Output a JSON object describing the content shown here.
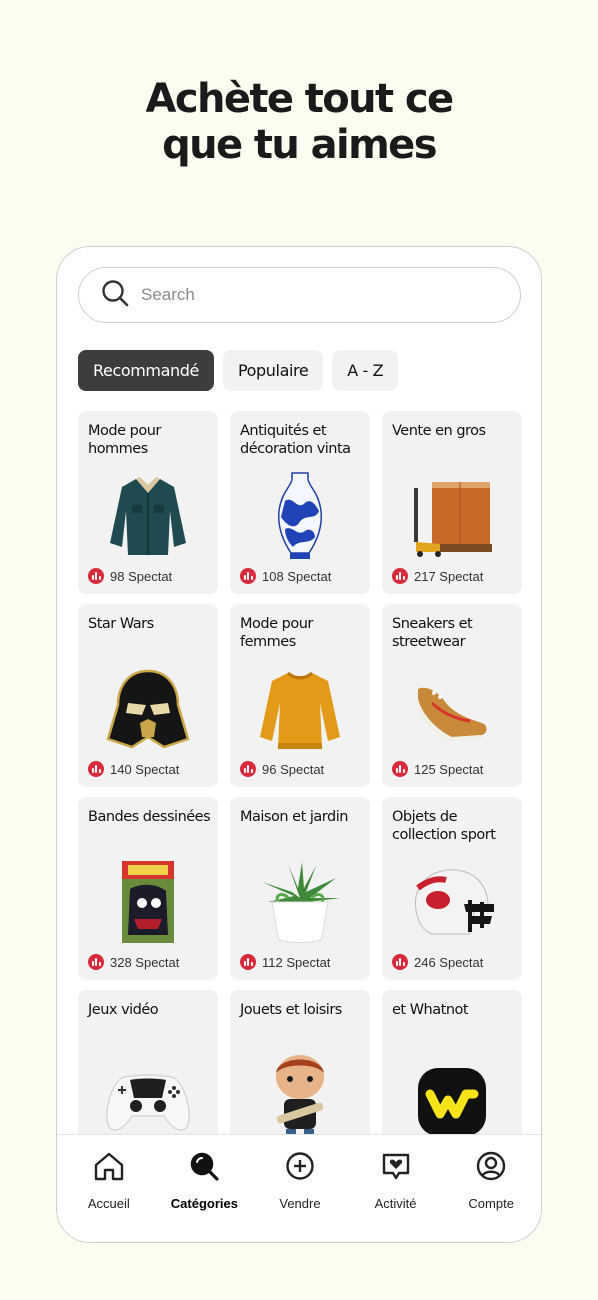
{
  "headline": {
    "line1": "Achète tout ce",
    "line2": "que tu aimes"
  },
  "search": {
    "placeholder": "Search",
    "value": ""
  },
  "tabs": [
    {
      "label": "Recommandé",
      "active": true
    },
    {
      "label": "Populaire",
      "active": false
    },
    {
      "label": "A - Z",
      "active": false
    }
  ],
  "categories": [
    {
      "title": "Mode pour hommes",
      "viewers": "98 Spectat",
      "image": "denim-jacket"
    },
    {
      "title": "Antiquités et décoration vinta",
      "viewers": "108 Spectat",
      "image": "blue-porcelain-vase"
    },
    {
      "title": "Vente en gros",
      "viewers": "217 Spectat",
      "image": "pallet-jack-crate"
    },
    {
      "title": "Star Wars",
      "viewers": "140 Spectat",
      "image": "darth-vader-helmet"
    },
    {
      "title": "Mode pour femmes",
      "viewers": "96 Spectat",
      "image": "yellow-sweater"
    },
    {
      "title": "Sneakers et streetwear",
      "viewers": "125 Spectat",
      "image": "sneaker"
    },
    {
      "title": "Bandes dessinées",
      "viewers": "328 Spectat",
      "image": "spiderman-comic"
    },
    {
      "title": "Maison et jardin",
      "viewers": "112 Spectat",
      "image": "potted-succulent"
    },
    {
      "title": "Objets de collection sport",
      "viewers": "246 Spectat",
      "image": "football-helmet"
    },
    {
      "title": "Jeux vidéo",
      "viewers": "",
      "image": "game-controller"
    },
    {
      "title": "Jouets et loisirs",
      "viewers": "",
      "image": "vinyl-figure"
    },
    {
      "title": "et Whatnot",
      "viewers": "",
      "image": "whatnot-logo"
    }
  ],
  "nav": [
    {
      "label": "Accueil",
      "icon": "home-icon",
      "active": false
    },
    {
      "label": "Catégories",
      "icon": "search-icon",
      "active": true
    },
    {
      "label": "Vendre",
      "icon": "plus-circle-icon",
      "active": false
    },
    {
      "label": "Activité",
      "icon": "heart-message-icon",
      "active": false
    },
    {
      "label": "Compte",
      "icon": "account-icon",
      "active": false
    }
  ],
  "colors": {
    "background": "#fdfcf0",
    "live_badge": "#d72a3a",
    "active_tab": "#3d3d3d",
    "card": "#f2f2f2"
  }
}
